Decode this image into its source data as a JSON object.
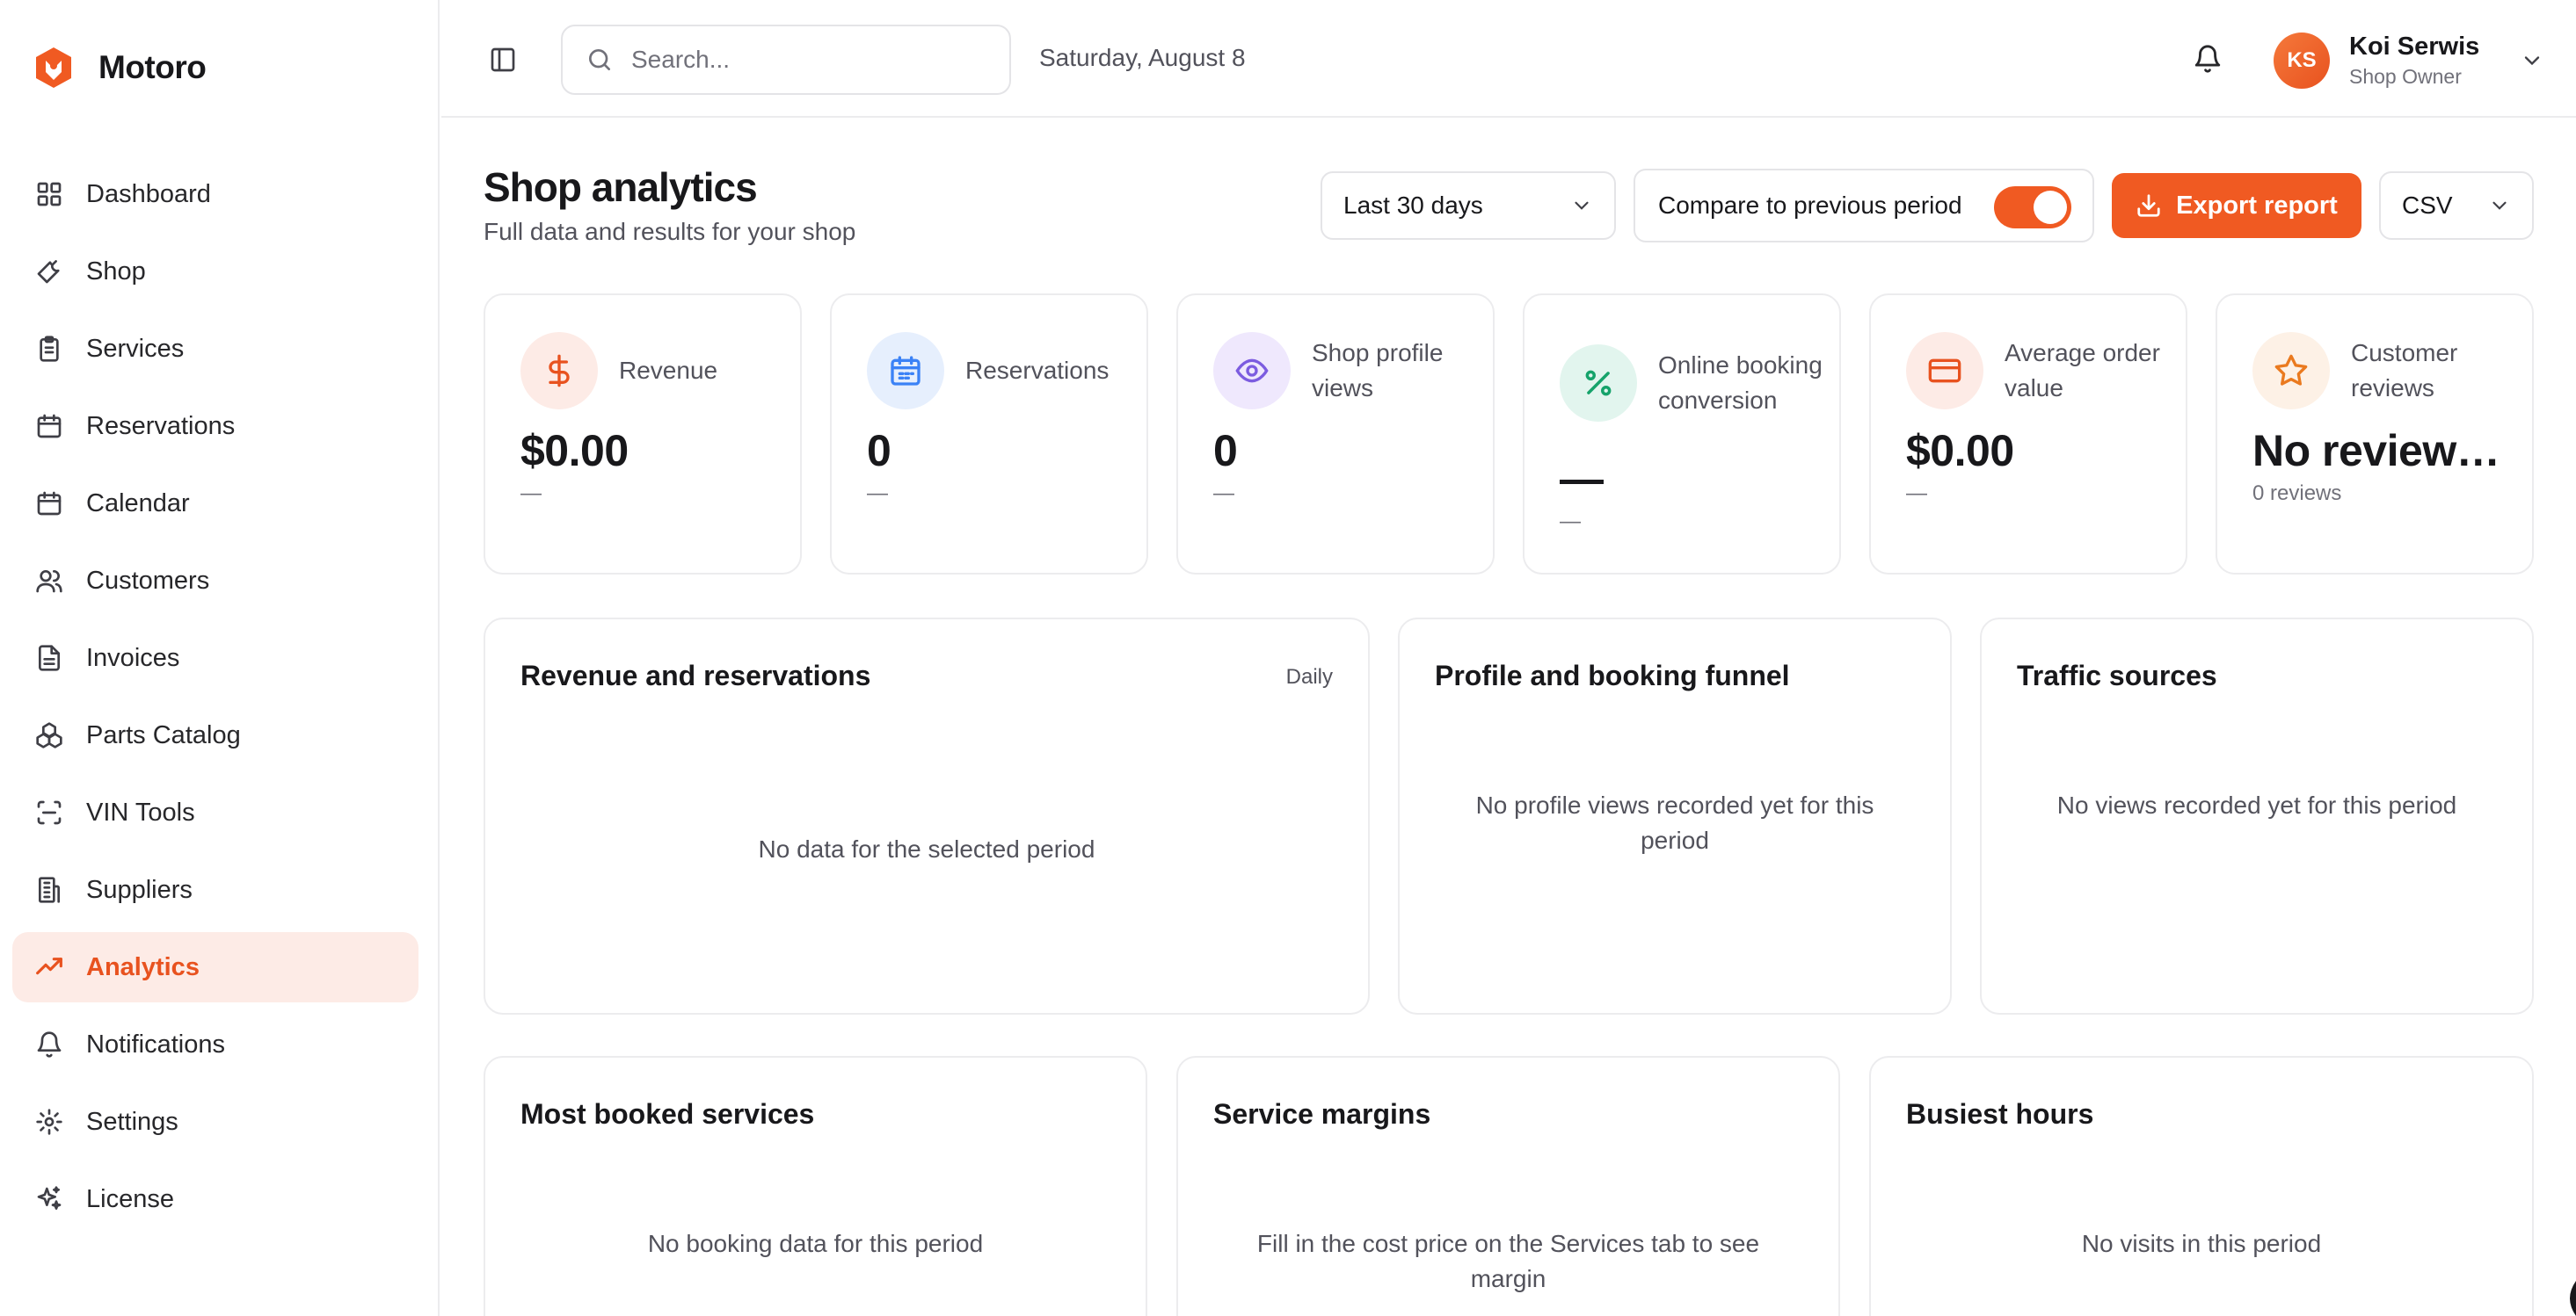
{
  "app": {
    "name": "Motoro"
  },
  "sidebar": {
    "items": [
      {
        "label": "Dashboard",
        "icon": "dashboard-icon"
      },
      {
        "label": "Shop",
        "icon": "wrench-icon"
      },
      {
        "label": "Services",
        "icon": "clipboard-icon"
      },
      {
        "label": "Reservations",
        "icon": "calendar-icon"
      },
      {
        "label": "Calendar",
        "icon": "calendar-icon"
      },
      {
        "label": "Customers",
        "icon": "users-icon"
      },
      {
        "label": "Invoices",
        "icon": "file-icon"
      },
      {
        "label": "Parts Catalog",
        "icon": "boxes-icon"
      },
      {
        "label": "VIN Tools",
        "icon": "scan-icon"
      },
      {
        "label": "Suppliers",
        "icon": "building-icon"
      },
      {
        "label": "Analytics",
        "icon": "trending-up-icon",
        "active": true
      },
      {
        "label": "Notifications",
        "icon": "bell-icon"
      },
      {
        "label": "Settings",
        "icon": "gear-icon"
      },
      {
        "label": "License",
        "icon": "sparkles-icon"
      }
    ]
  },
  "topbar": {
    "search_placeholder": "Search...",
    "date": "Saturday, August 8",
    "user": {
      "initials": "KS",
      "name": "Koi Serwis",
      "role": "Shop Owner"
    }
  },
  "header": {
    "title": "Shop analytics",
    "subtitle": "Full data and results for your shop",
    "period": "Last 30 days",
    "compare_label": "Compare to previous period",
    "compare_enabled": true,
    "export_label": "Export report",
    "format": "CSV"
  },
  "stats": [
    {
      "label": "Revenue",
      "value": "$0.00",
      "sub": "—",
      "icon": "dollar-icon"
    },
    {
      "label": "Reservations",
      "value": "0",
      "sub": "—",
      "icon": "calendar-icon"
    },
    {
      "label": "Shop profile views",
      "value": "0",
      "sub": "—",
      "icon": "eye-icon"
    },
    {
      "label": "Online booking conversion",
      "value": "—",
      "sub": "—",
      "icon": "percent-icon"
    },
    {
      "label": "Average order value",
      "value": "$0.00",
      "sub": "—",
      "icon": "card-icon"
    },
    {
      "label": "Customer reviews",
      "value": "No review…",
      "sub": "0 reviews",
      "icon": "star-icon"
    }
  ],
  "panels": {
    "revenue": {
      "title": "Revenue and reservations",
      "meta": "Daily",
      "empty": "No data for the selected period"
    },
    "funnel": {
      "title": "Profile and booking funnel",
      "empty": "No profile views recorded yet for this period"
    },
    "traffic": {
      "title": "Traffic sources",
      "empty": "No views recorded yet for this period"
    },
    "services": {
      "title": "Most booked services",
      "empty": "No booking data for this period"
    },
    "margins": {
      "title": "Service margins",
      "empty": "Fill in the cost price on the Services tab to see margin"
    },
    "hours": {
      "title": "Busiest hours",
      "empty": "No visits in this period"
    }
  },
  "colors": {
    "accent": "#f05a22",
    "accent_soft": "#fdebe6",
    "revenue_icon_bg": "#fdebe6",
    "reservations_icon_bg": "#e6effd",
    "views_icon_bg": "#efe8fd",
    "conversion_icon_bg": "#e2f5ee",
    "aov_icon_bg": "#fdebe6",
    "reviews_icon_bg": "#fdf1e6"
  }
}
